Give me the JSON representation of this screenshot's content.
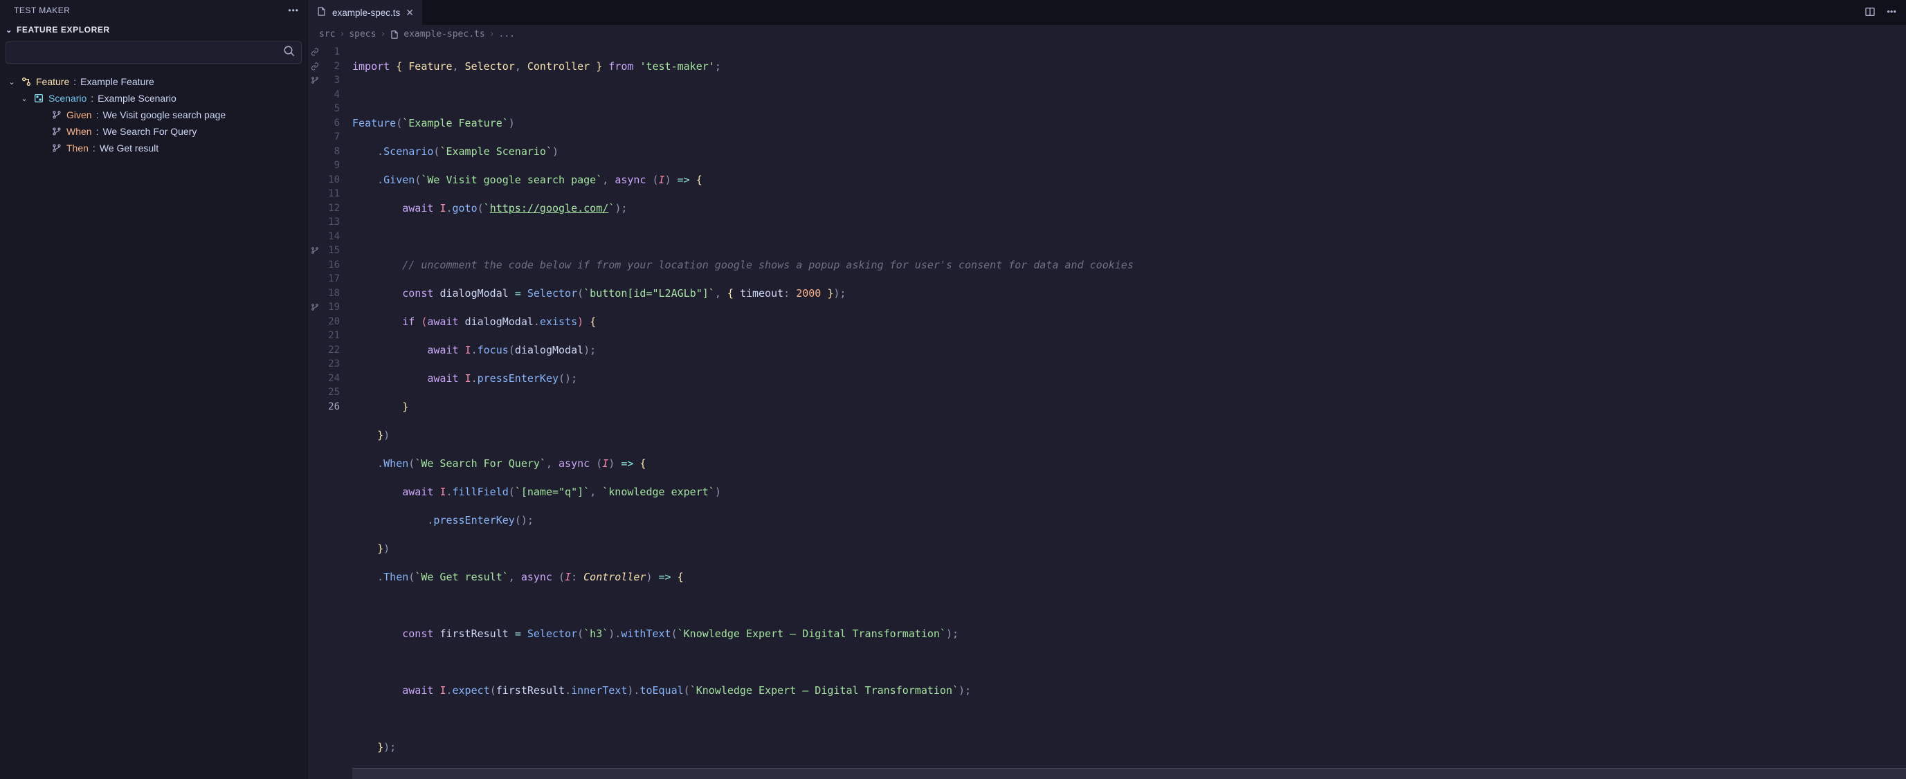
{
  "sidebar": {
    "title": "TEST MAKER",
    "section": "FEATURE EXPLORER",
    "search_placeholder": "",
    "tree": {
      "feature_kw": "Feature",
      "feature_name": "Example Feature",
      "scenario_kw": "Scenario",
      "scenario_name": "Example Scenario",
      "steps": [
        {
          "kw": "Given",
          "text": "We Visit google search page"
        },
        {
          "kw": "When",
          "text": "We Search For Query"
        },
        {
          "kw": "Then",
          "text": "We Get result"
        }
      ]
    }
  },
  "tab": {
    "filename": "example-spec.ts"
  },
  "breadcrumbs": {
    "parts": [
      "src",
      "specs",
      "example-spec.ts",
      "..."
    ]
  },
  "editor": {
    "line_count": 26,
    "glyphs": {
      "1": "link",
      "2": "link",
      "3": "branch",
      "15": "branch",
      "19": "branch"
    },
    "tokens": {
      "import_kw": "import",
      "from_kw": "from",
      "await_kw": "await",
      "const_kw": "const",
      "if_kw": "if",
      "async_kw": "async",
      "Feature": "Feature",
      "Selector": "Selector",
      "Controller": "Controller",
      "pkg": "'test-maker'",
      "feature_str": "`Example Feature`",
      "scenario_str": "`Example Scenario`",
      "given_str": "`We Visit google search page`",
      "when_str": "`We Search For Query`",
      "then_str": "`We Get result`",
      "url": "https://google.com/",
      "comment": "// uncomment the code below if from your location google shows a popup asking for user's consent for data and cookies",
      "selector_btn": "`button[id=\"L2AGLb\"]`",
      "timeout_key": "timeout",
      "timeout_val": "2000",
      "dialogModal": "dialogModal",
      "exists": "exists",
      "focus": "focus",
      "pressEnterKey": "pressEnterKey",
      "goto": "goto",
      "I": "I",
      "fillField": "fillField",
      "nameq": "`[name=\"q\"]`",
      "knowledge": "`knowledge expert`",
      "firstResult": "firstResult",
      "h3": "`h3`",
      "withText": "withText",
      "kexp": "`Knowledge Expert – Digital Transformation`",
      "expect": "expect",
      "innerText": "innerText",
      "toEqual": "toEqual",
      "Scenario": "Scenario",
      "Given": "Given",
      "When": "When",
      "Then": "Then"
    }
  }
}
